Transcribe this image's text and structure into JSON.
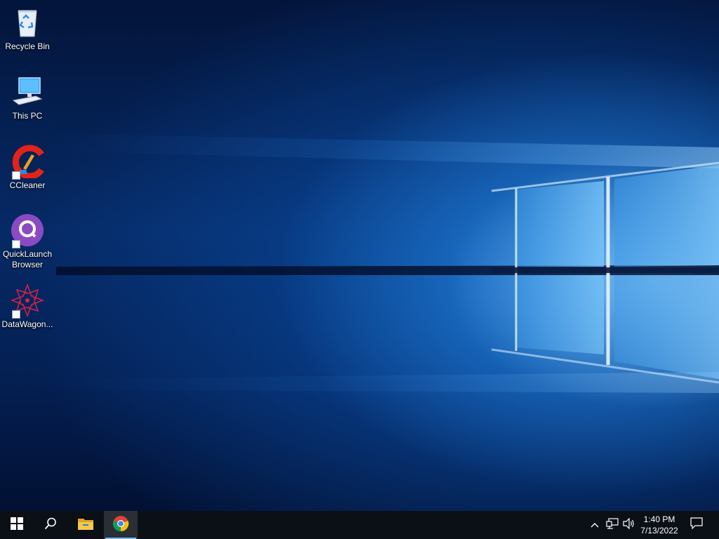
{
  "desktop": {
    "icons": [
      {
        "label": "Recycle Bin",
        "icon": "recycle-bin-icon"
      },
      {
        "label": "This PC",
        "icon": "computer-icon"
      },
      {
        "label": "CCleaner",
        "icon": "ccleaner-icon"
      },
      {
        "label": "QuickLaunch Browser",
        "icon": "quicklaunch-browser-icon"
      },
      {
        "label": "DataWagon...",
        "icon": "datawagon-icon"
      }
    ]
  },
  "taskbar": {
    "buttons": [
      {
        "name": "start-button",
        "icon": "windows-logo-icon"
      },
      {
        "name": "search-button",
        "icon": "search-icon"
      },
      {
        "name": "file-explorer-button",
        "icon": "folder-icon"
      },
      {
        "name": "chrome-button",
        "icon": "chrome-icon",
        "active": true
      }
    ],
    "tray": {
      "icons": [
        "chevron-up-icon",
        "network-icon",
        "volume-icon"
      ],
      "time": "1:40 PM",
      "date": "7/13/2022",
      "notification_icon": "action-center-icon"
    },
    "colors": {
      "background": "#0b0f16",
      "active_underline": "#76b9ed"
    }
  }
}
